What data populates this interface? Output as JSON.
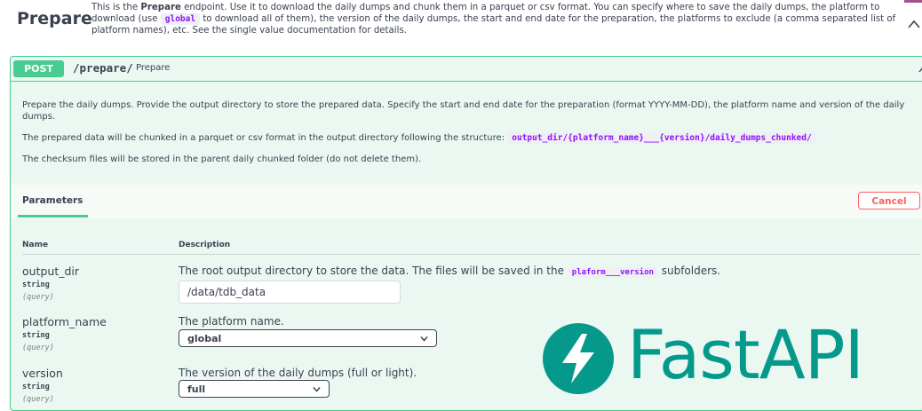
{
  "tag": {
    "title": "Prepare",
    "desc_prefix": "This is the ",
    "desc_bold": "Prepare",
    "desc_mid": " endpoint. Use it to download the daily dumps and chunk them in a parquet or csv format. You can specify where to save the daily dumps, the platform to download (use ",
    "desc_code": "global",
    "desc_suffix": " to download all of them), the version of the daily dumps, the start and end date for the preparation, the platforms to exclude (a comma separated list of platform names), etc. See the single value documentation for details.",
    "collapse_icon": "chevron-up-icon"
  },
  "operation": {
    "method": "POST",
    "path": "/prepare/",
    "summary": "Prepare",
    "expand_icon": "chevron-up-icon",
    "color": "#49cc90",
    "desc1": "Prepare the daily dumps. Provide the output directory to store the prepared data. Specify the start and end date for the preparation (format YYYY-MM-DD), the platform name and version of the daily dumps.",
    "desc2_prefix": "The prepared data will be chunked in a parquet or csv format in the output directory following the structure: ",
    "desc2_code": "output_dir/{platform_name}___{version}/daily_dumps_chunked/",
    "desc3": "The checksum files will be stored in the parent daily chunked folder (do not delete them)."
  },
  "parameters": {
    "tab_label": "Parameters",
    "cancel_label": "Cancel",
    "col_name": "Name",
    "col_description": "Description",
    "items": [
      {
        "name": "output_dir",
        "type": "string",
        "in": "(query)",
        "desc_prefix": "The root output directory to store the data. The files will be saved in the ",
        "desc_code": "plaform___version",
        "desc_suffix": " subfolders.",
        "value": "/data/tdb_data"
      },
      {
        "name": "platform_name",
        "type": "string",
        "in": "(query)",
        "desc": "The platform name.",
        "selected": "global"
      },
      {
        "name": "version",
        "type": "string",
        "in": "(query)",
        "desc": "The version of the daily dumps (full or light).",
        "selected": "full"
      }
    ]
  },
  "watermark": {
    "text": "FastAPI",
    "icon": "fastapi-bolt-icon",
    "color": "#05998b"
  }
}
